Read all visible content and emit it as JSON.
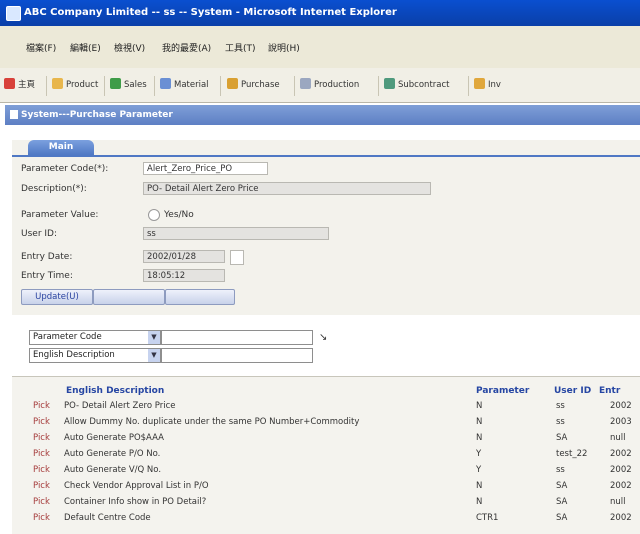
{
  "window": {
    "title": "ABC Company Limited -- ss -- System - Microsoft Internet Explorer"
  },
  "menu": [
    "檔案(F)",
    "編輯(E)",
    "檢視(V)",
    "我的最愛(A)",
    "工具(T)",
    "說明(H)"
  ],
  "modules": [
    "主頁",
    "Product",
    "Sales",
    "Material",
    "Purchase",
    "Production",
    "Subcontract",
    "Inv"
  ],
  "section_title": "System---Purchase Parameter",
  "tab_label": "Main",
  "form": {
    "param_code_label": "Parameter Code(*):",
    "param_code_value": "Alert_Zero_Price_PO",
    "description_label": "Description(*):",
    "description_value": "PO- Detail Alert Zero Price",
    "param_value_label": "Parameter Value:",
    "param_value_option": "Yes/No",
    "user_id_label": "User ID:",
    "user_id_value": "ss",
    "entry_date_label": "Entry Date:",
    "entry_date_value": "2002/01/28",
    "entry_time_label": "Entry Time:",
    "entry_time_value": "18:05:12",
    "update_label": "Update(U)"
  },
  "search": {
    "field1": "Parameter Code",
    "field2": "English Description"
  },
  "table": {
    "headers": [
      "English Description",
      "Parameter",
      "User ID",
      "Entr"
    ],
    "pick_label": "Pick",
    "rows": [
      [
        "PO- Detail Alert Zero Price",
        "N",
        "ss",
        "2002"
      ],
      [
        "Allow Dummy No. duplicate under the same PO Number+Commodity",
        "N",
        "ss",
        "2003"
      ],
      [
        "Auto Generate PO$AAA",
        "N",
        "SA",
        "null"
      ],
      [
        "Auto Generate P/O No.",
        "Y",
        "test_22",
        "2002"
      ],
      [
        "Auto Generate V/Q No.",
        "Y",
        "ss",
        "2002"
      ],
      [
        "Check Vendor Approval List in P/O",
        "N",
        "SA",
        "2002"
      ],
      [
        "Container Info show in PO Detail?",
        "N",
        "SA",
        "null"
      ],
      [
        "Default Centre Code",
        "CTR1",
        "SA",
        "2002"
      ]
    ]
  },
  "colors": {
    "titlebar": "#0a4fd0",
    "section": "#5d7fc4",
    "header_text": "#2646a3"
  }
}
